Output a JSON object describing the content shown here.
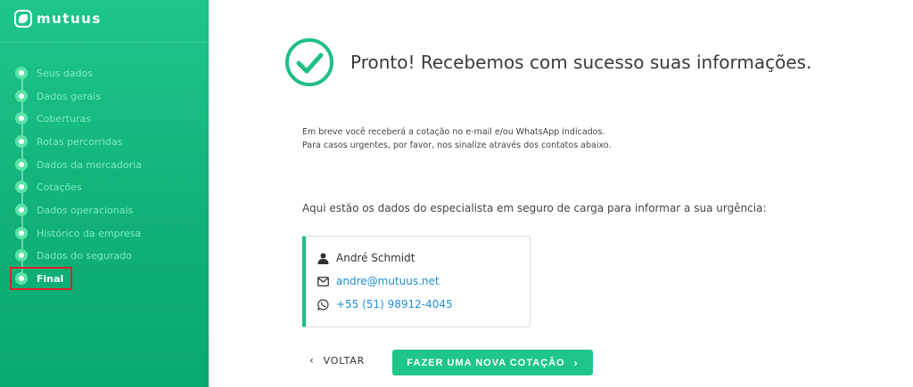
{
  "brand": {
    "name": "mutuus",
    "color": "#1ec68a"
  },
  "sidebar": {
    "steps": [
      {
        "label": "Seus dados",
        "state": "done"
      },
      {
        "label": "Dados gerais",
        "state": "done"
      },
      {
        "label": "Coberturas",
        "state": "done"
      },
      {
        "label": "Rotas percorridas",
        "state": "done"
      },
      {
        "label": "Dados da mercadoria",
        "state": "done"
      },
      {
        "label": "Cotações",
        "state": "done"
      },
      {
        "label": "Dados operacionais",
        "state": "done"
      },
      {
        "label": "Histórico da empresa",
        "state": "done"
      },
      {
        "label": "Dados do segurado",
        "state": "done"
      },
      {
        "label": "Final",
        "state": "active"
      }
    ]
  },
  "main": {
    "headline": "Pronto! Recebemos com sucesso suas informações.",
    "info_line1": "Em breve você receberá a cotação no e-mail e/ou WhatsApp indicados.",
    "info_line2": "Para casos urgentes, por favor, nos sinalize através dos contatos abaixo.",
    "urgency": "Aqui estão os dados do especialista em seguro de carga para informar a sua urgência:",
    "specialist": {
      "name": "André Schmidt",
      "email": "andre@mutuus.net",
      "phone": "+55 (51) 98912-4045"
    },
    "back_label": "VOLTAR",
    "new_quote_label": "FAZER UMA NOVA COTAÇÃO"
  }
}
